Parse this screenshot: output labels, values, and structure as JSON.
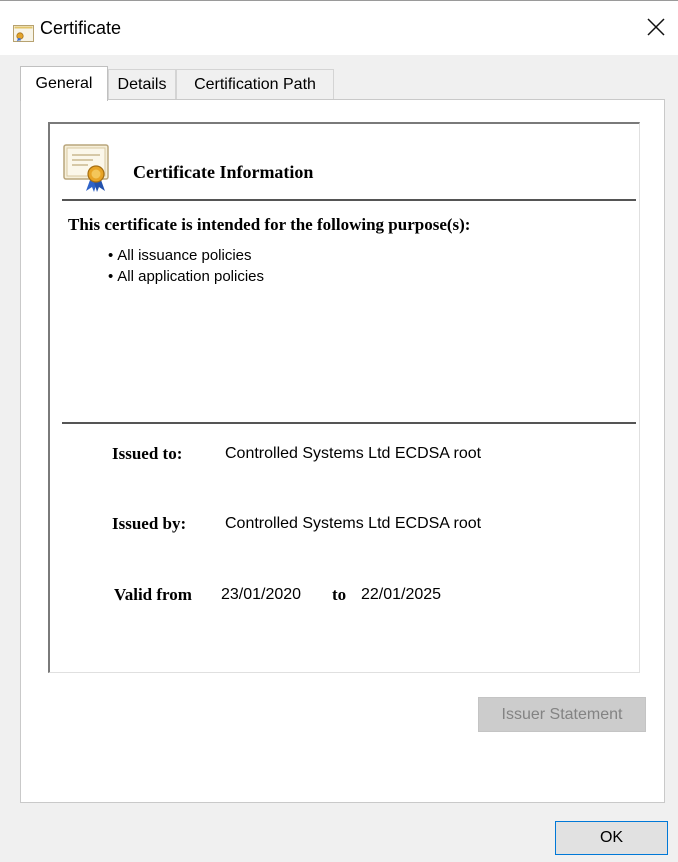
{
  "window": {
    "title": "Certificate"
  },
  "tabs": [
    {
      "label": "General",
      "active": true
    },
    {
      "label": "Details",
      "active": false
    },
    {
      "label": "Certification Path",
      "active": false
    }
  ],
  "info": {
    "title": "Certificate Information",
    "purpose_heading": "This certificate is intended for the following purpose(s):",
    "purposes": [
      "All issuance policies",
      "All application policies"
    ],
    "issued_to_label": "Issued to:",
    "issued_to_value": "Controlled Systems Ltd ECDSA root",
    "issued_by_label": "Issued by:",
    "issued_by_value": "Controlled Systems Ltd ECDSA root",
    "valid_from_label": "Valid from",
    "valid_from_value": "23/01/2020",
    "valid_to_label": "to",
    "valid_to_value": "22/01/2025"
  },
  "buttons": {
    "issuer_statement": "Issuer Statement",
    "ok": "OK"
  },
  "icons": {
    "title": "certificate-icon",
    "close": "close-icon",
    "info": "certificate-ribbon-icon"
  },
  "colors": {
    "dialog_background": "#f0f0f0",
    "panel_background": "#ffffff",
    "ok_border": "#0078d7",
    "disabled_text": "#838383"
  }
}
